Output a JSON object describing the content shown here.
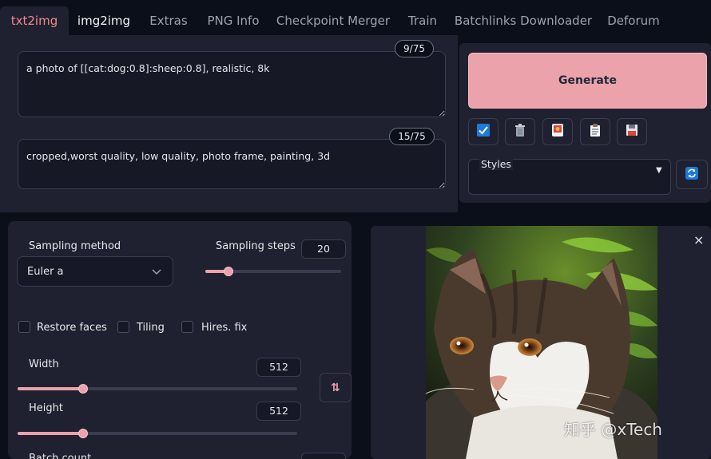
{
  "tabs": [
    {
      "label": "txt2img"
    },
    {
      "label": "img2img"
    },
    {
      "label": "Extras"
    },
    {
      "label": "PNG Info"
    },
    {
      "label": "Checkpoint Merger"
    },
    {
      "label": "Train"
    },
    {
      "label": "Batchlinks Downloader"
    },
    {
      "label": "Deforum"
    }
  ],
  "prompt": {
    "positive": "a photo of [[cat:dog:0.8]:sheep:0.8], realistic, 8k",
    "positive_counter": "9/75",
    "negative": "cropped,worst quality, low quality, photo frame, painting, 3d",
    "negative_counter": "15/75"
  },
  "generate": {
    "label": "Generate",
    "tools": [
      {
        "icon": "checkbox-icon"
      },
      {
        "icon": "trash-icon"
      },
      {
        "icon": "image-icon"
      },
      {
        "icon": "clipboard-icon"
      },
      {
        "icon": "save-icon"
      }
    ],
    "styles_label": "Styles",
    "styles_value": ""
  },
  "settings": {
    "sampling_method_label": "Sampling method",
    "sampling_method_value": "Euler a",
    "sampling_steps_label": "Sampling steps",
    "sampling_steps_value": "20",
    "sampling_steps_fraction": 0.17,
    "checkboxes": [
      {
        "label": "Restore faces",
        "checked": false
      },
      {
        "label": "Tiling",
        "checked": false
      },
      {
        "label": "Hires. fix",
        "checked": false
      }
    ],
    "width_label": "Width",
    "width_value": "512",
    "height_label": "Height",
    "height_value": "512",
    "batch_count_label": "Batch count"
  },
  "gallery": {
    "close_label": "×",
    "image_subject": "cat photo"
  },
  "watermark": "知乎 @xTech",
  "colors": {
    "accent": "#eba2ab",
    "background": "#0b0f19",
    "panel": "#1f2130"
  }
}
